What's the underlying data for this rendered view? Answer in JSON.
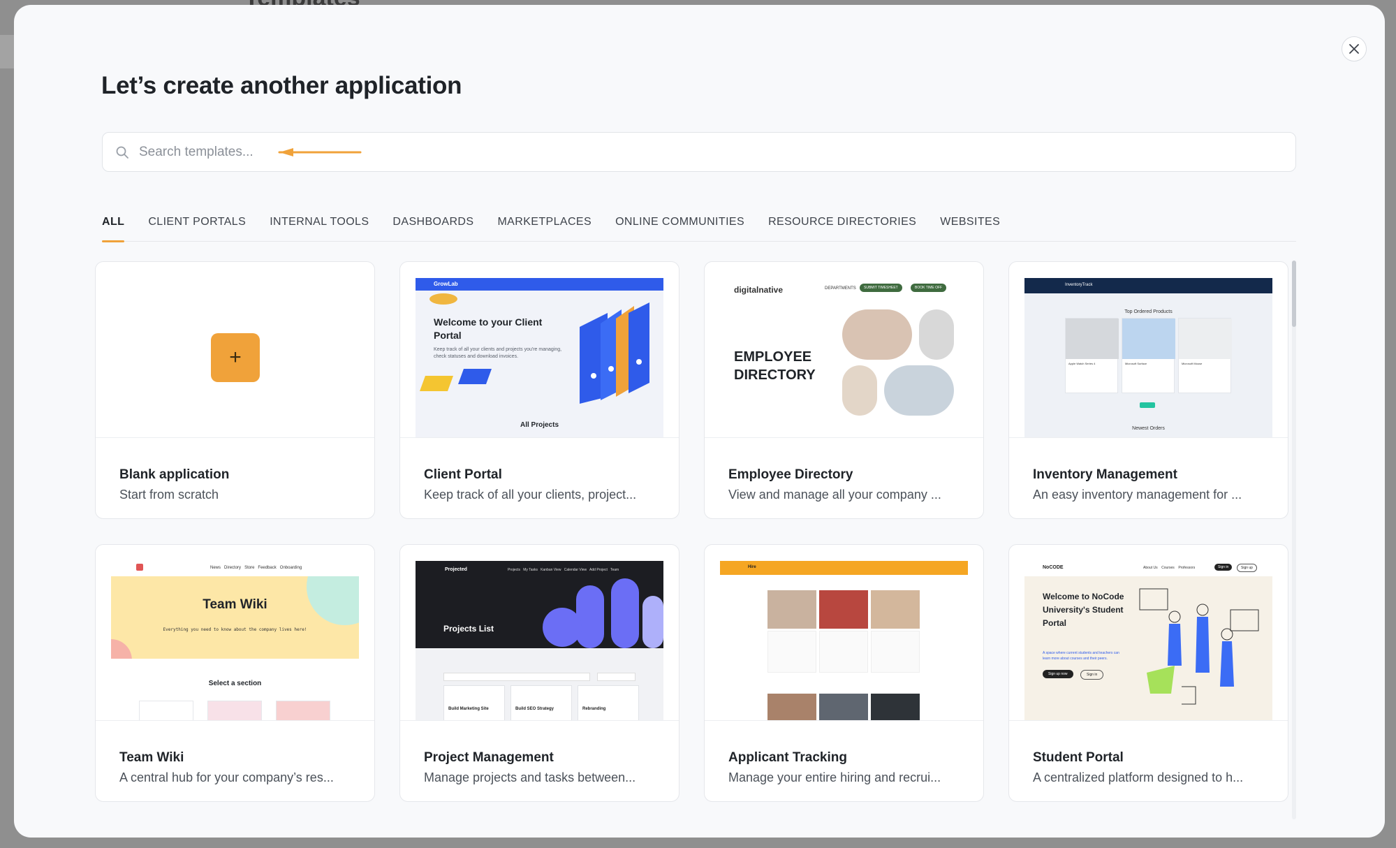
{
  "backdrop": {
    "title": "Templates"
  },
  "modal": {
    "title": "Let’s create another application",
    "close_icon": "close-icon"
  },
  "search": {
    "placeholder": "Search templates...",
    "value": ""
  },
  "tabs": [
    {
      "label": "ALL",
      "active": true
    },
    {
      "label": "CLIENT PORTALS",
      "active": false
    },
    {
      "label": "INTERNAL TOOLS",
      "active": false
    },
    {
      "label": "DASHBOARDS",
      "active": false
    },
    {
      "label": "MARKETPLACES",
      "active": false
    },
    {
      "label": "ONLINE COMMUNITIES",
      "active": false
    },
    {
      "label": "RESOURCE DIRECTORIES",
      "active": false
    },
    {
      "label": "WEBSITES",
      "active": false
    }
  ],
  "colors": {
    "accent": "#f0a23a",
    "title": "#1f2328",
    "muted": "#4b5159"
  },
  "cards": [
    {
      "title": "Blank application",
      "desc": "Start from scratch",
      "icon": "plus-icon"
    },
    {
      "title": "Client Portal",
      "desc": "Keep track of all your clients, project...",
      "preview": {
        "brand": "GrowLab",
        "headline": "Welcome to your Client Portal",
        "body": "Keep track of all your clients and projects you're managing, check statuses and download invoices.",
        "footer": "All Projects"
      }
    },
    {
      "title": "Employee Directory",
      "desc": "View and manage all your company ...",
      "preview": {
        "brand": "digitalnative",
        "headline": "EMPLOYEE DIRECTORY",
        "nav": "DEPARTMENTS",
        "btn1": "SUBMIT TIMESHEET",
        "btn2": "BOOK TIME OFF"
      }
    },
    {
      "title": "Inventory Management",
      "desc": "An easy inventory management for ...",
      "preview": {
        "brand": "InventoryTrack",
        "headline": "Top Ordered Products",
        "footer": "Newest Orders",
        "product1": "Apple Watch Series 4",
        "product2": "Microsoft Surface",
        "product3": "Microsoft Mouse"
      }
    },
    {
      "title": "Team Wiki",
      "desc": "A central hub for your company’s res...",
      "preview": {
        "headline": "Team Wiki",
        "sub": "Everything you need to know about the company lives here!",
        "section": "Select a section",
        "nav": [
          "News",
          "Directory",
          "Store",
          "Feedback",
          "Onboarding"
        ]
      }
    },
    {
      "title": "Project Management",
      "desc": "Manage projects and tasks between...",
      "preview": {
        "brand": "Projected",
        "headline": "Projects List",
        "nav": [
          "Projects",
          "My Tasks",
          "Kanban View",
          "Calendar View",
          "Add Project",
          "Team"
        ],
        "items": [
          "Build Marketing Site",
          "Build SEO Strategy",
          "Rebranding"
        ]
      }
    },
    {
      "title": "Applicant Tracking",
      "desc": "Manage your entire hiring and recrui...",
      "preview": {
        "brand": "Hire"
      }
    },
    {
      "title": "Student Portal",
      "desc": "A centralized platform designed to h...",
      "preview": {
        "brand": "NoCODE",
        "headline": "Welcome to NoCode University's Student Portal",
        "sub": "A space where current students and teachers can learn more about courses and their peers.",
        "btn1": "Sign up now",
        "btn2": "Sign in",
        "nav": [
          "About Us",
          "Courses",
          "Professors"
        ],
        "nav_btn1": "Sign in",
        "nav_btn2": "Sign up"
      }
    }
  ]
}
